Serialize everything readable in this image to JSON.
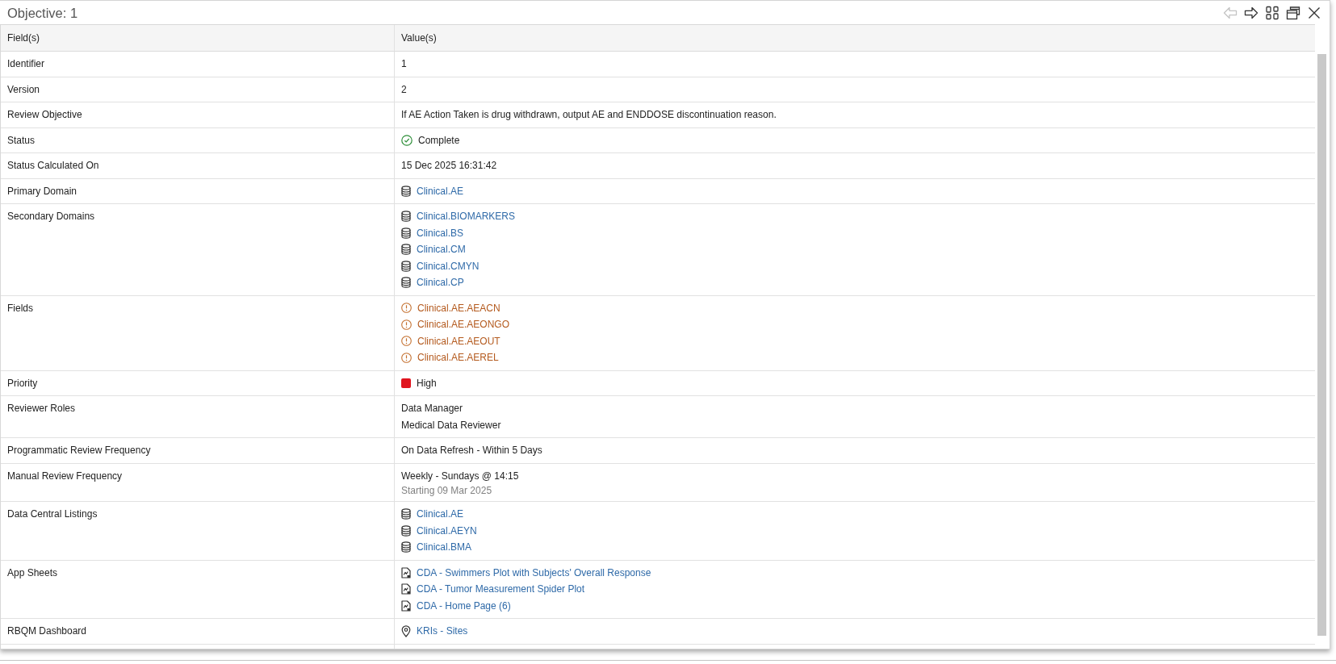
{
  "window": {
    "title": "Objective: 1",
    "toolbar": [
      {
        "kind": "back",
        "disabled": true
      },
      {
        "kind": "forward",
        "disabled": false
      },
      {
        "kind": "layout",
        "disabled": false
      },
      {
        "kind": "restore",
        "disabled": false
      },
      {
        "kind": "close",
        "disabled": false
      }
    ]
  },
  "table": {
    "columns": [
      "Field(s)",
      "Value(s)"
    ],
    "rows": [
      {
        "field": "Identifier",
        "values": [
          {
            "kind": "text",
            "text": "1"
          }
        ]
      },
      {
        "field": "Version",
        "values": [
          {
            "kind": "text",
            "text": "2"
          }
        ]
      },
      {
        "field": "Review Objective",
        "values": [
          {
            "kind": "text",
            "text": "If AE Action Taken is drug withdrawn, output AE and ENDDOSE discontinuation reason."
          }
        ]
      },
      {
        "field": "Status",
        "values": [
          {
            "kind": "status",
            "text": "Complete"
          }
        ]
      },
      {
        "field": "Status Calculated On",
        "values": [
          {
            "kind": "text",
            "text": "15 Dec 2025 16:31:42"
          }
        ]
      },
      {
        "field": "Primary Domain",
        "values": [
          {
            "kind": "dataset",
            "text": "Clinical.AE"
          }
        ]
      },
      {
        "field": "Secondary Domains",
        "values": [
          {
            "kind": "dataset",
            "text": "Clinical.BIOMARKERS"
          },
          {
            "kind": "dataset",
            "text": "Clinical.BS"
          },
          {
            "kind": "dataset",
            "text": "Clinical.CM"
          },
          {
            "kind": "dataset",
            "text": "Clinical.CMYN"
          },
          {
            "kind": "dataset",
            "text": "Clinical.CP"
          }
        ]
      },
      {
        "field": "Fields",
        "values": [
          {
            "kind": "warning",
            "text": "Clinical.AE.AEACN"
          },
          {
            "kind": "warning",
            "text": "Clinical.AE.AEONGO"
          },
          {
            "kind": "warning",
            "text": "Clinical.AE.AEOUT"
          },
          {
            "kind": "warning",
            "text": "Clinical.AE.AEREL"
          }
        ]
      },
      {
        "field": "Priority",
        "values": [
          {
            "kind": "priority",
            "text": "High",
            "color": "#e0141e"
          }
        ]
      },
      {
        "field": "Reviewer Roles",
        "values": [
          {
            "kind": "text",
            "text": "Data Manager"
          },
          {
            "kind": "text",
            "text": "Medical Data Reviewer"
          }
        ]
      },
      {
        "field": "Programmatic Review Frequency",
        "values": [
          {
            "kind": "text",
            "text": "On Data Refresh - Within 5 Days"
          }
        ]
      },
      {
        "field": "Manual Review Frequency",
        "values": [
          {
            "kind": "text",
            "text": "Weekly - Sundays @ 14:15"
          },
          {
            "kind": "subtext",
            "text": "Starting 09 Mar 2025"
          }
        ]
      },
      {
        "field": "Data Central Listings",
        "values": [
          {
            "kind": "dataset",
            "text": "Clinical.AE"
          },
          {
            "kind": "dataset",
            "text": "Clinical.AEYN"
          },
          {
            "kind": "dataset",
            "text": "Clinical.BMA"
          }
        ]
      },
      {
        "field": "App Sheets",
        "values": [
          {
            "kind": "sheet",
            "text": "CDA - Swimmers Plot with Subjects' Overall Response"
          },
          {
            "kind": "sheet",
            "text": "CDA - Tumor Measurement Spider Plot"
          },
          {
            "kind": "sheet",
            "text": "CDA - Home Page (6)"
          }
        ]
      },
      {
        "field": "RBQM Dashboard",
        "values": [
          {
            "kind": "dashboard",
            "text": "KRIs - Sites"
          }
        ]
      }
    ]
  }
}
